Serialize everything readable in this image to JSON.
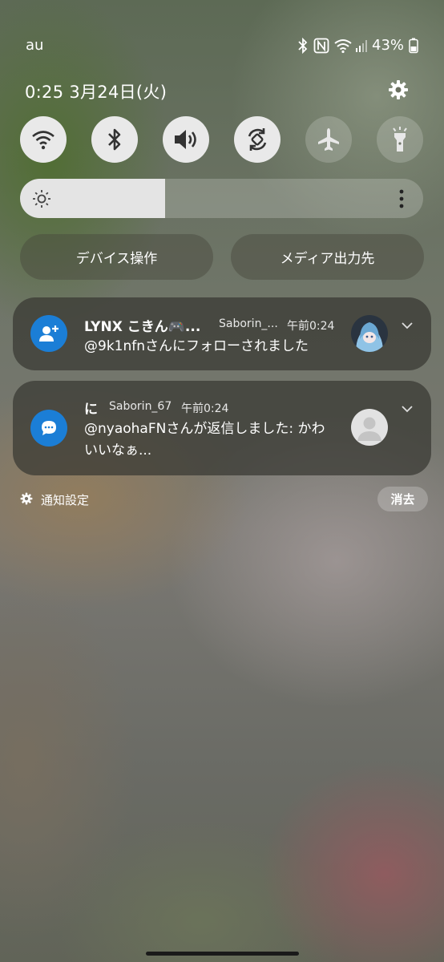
{
  "status_bar": {
    "carrier": "au",
    "battery_percent": "43%",
    "icons": [
      "bluetooth-icon",
      "nfc-icon",
      "wifi-icon",
      "signal-icon",
      "battery-icon"
    ]
  },
  "header": {
    "time_date": "0:25  3月24日(火)",
    "settings_icon": "gear-icon"
  },
  "quick_settings": [
    {
      "name": "wifi",
      "icon": "wifi-icon",
      "state": "on"
    },
    {
      "name": "bluetooth",
      "icon": "bluetooth-icon",
      "state": "on"
    },
    {
      "name": "sound",
      "icon": "speaker-icon",
      "state": "on"
    },
    {
      "name": "auto-rotate",
      "icon": "rotate-icon",
      "state": "on"
    },
    {
      "name": "airplane-mode",
      "icon": "airplane-icon",
      "state": "off"
    },
    {
      "name": "flashlight",
      "icon": "flashlight-icon",
      "state": "off"
    }
  ],
  "brightness": {
    "level": 0.36,
    "icon": "sun-icon"
  },
  "buttons": {
    "device_control": "デバイス操作",
    "media_output": "メディア出力先"
  },
  "notifications": [
    {
      "title": "LYNX こきん🎮...",
      "account": "Saborin_...",
      "time": "午前0:24",
      "body": "@9k1nfnさんにフォローされました",
      "app_icon": "follow-icon"
    },
    {
      "title": "に",
      "account": "Saborin_67",
      "time": "午前0:24",
      "body": "@nyaohaFNさんが返信しました: かわいいなぁ...",
      "app_icon": "reply-bubble-icon"
    }
  ],
  "footer": {
    "notification_settings": "通知設定",
    "clear": "消去"
  },
  "colors": {
    "accent": "#1b7ed6",
    "toggle_on": "#e9e9e9"
  }
}
